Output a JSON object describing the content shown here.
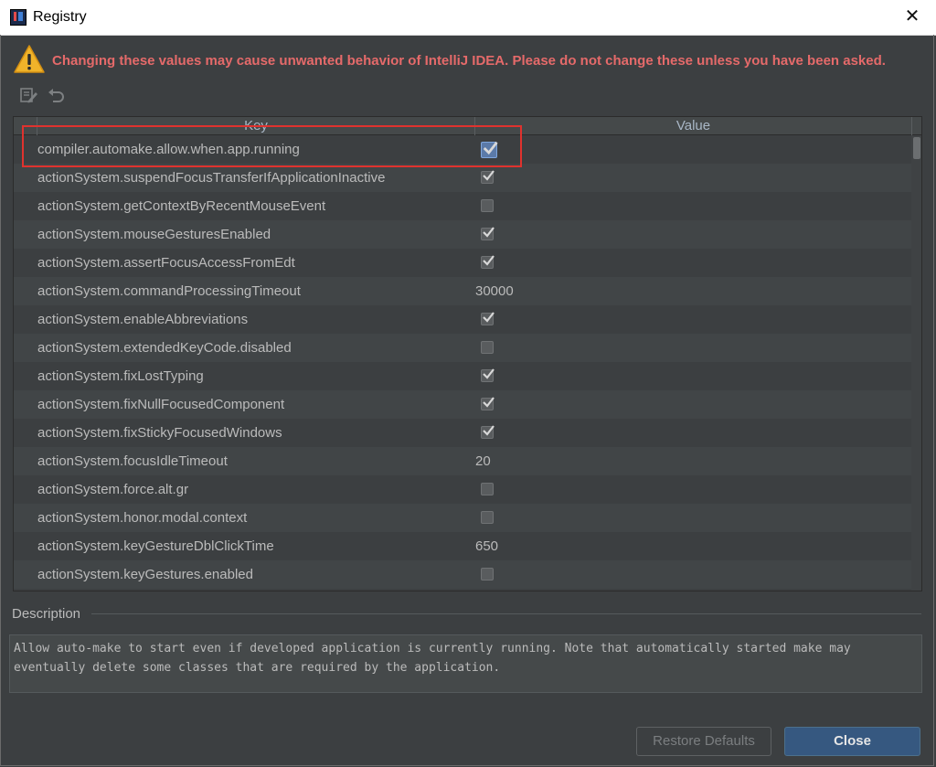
{
  "window": {
    "title": "Registry",
    "close_glyph": "✕"
  },
  "warning": {
    "icon": "warning-triangle-icon",
    "text": "Changing these values may cause unwanted behavior of IntelliJ IDEA. Please do not change these unless you have been asked."
  },
  "toolbar": {
    "edit_icon": "edit-icon",
    "undo_icon": "revert-icon"
  },
  "table": {
    "headers": {
      "key": "Key",
      "value": "Value"
    },
    "rows": [
      {
        "key": "compiler.automake.allow.when.app.running",
        "type": "checkbox",
        "checked": true
      },
      {
        "key": "actionSystem.suspendFocusTransferIfApplicationInactive",
        "type": "checkbox",
        "checked": true
      },
      {
        "key": "actionSystem.getContextByRecentMouseEvent",
        "type": "checkbox",
        "checked": false
      },
      {
        "key": "actionSystem.mouseGesturesEnabled",
        "type": "checkbox",
        "checked": true
      },
      {
        "key": "actionSystem.assertFocusAccessFromEdt",
        "type": "checkbox",
        "checked": true
      },
      {
        "key": "actionSystem.commandProcessingTimeout",
        "type": "text",
        "value": "30000"
      },
      {
        "key": "actionSystem.enableAbbreviations",
        "type": "checkbox",
        "checked": true
      },
      {
        "key": "actionSystem.extendedKeyCode.disabled",
        "type": "checkbox",
        "checked": false
      },
      {
        "key": "actionSystem.fixLostTyping",
        "type": "checkbox",
        "checked": true
      },
      {
        "key": "actionSystem.fixNullFocusedComponent",
        "type": "checkbox",
        "checked": true
      },
      {
        "key": "actionSystem.fixStickyFocusedWindows",
        "type": "checkbox",
        "checked": true
      },
      {
        "key": "actionSystem.focusIdleTimeout",
        "type": "text",
        "value": "20"
      },
      {
        "key": "actionSystem.force.alt.gr",
        "type": "checkbox",
        "checked": false
      },
      {
        "key": "actionSystem.honor.modal.context",
        "type": "checkbox",
        "checked": false
      },
      {
        "key": "actionSystem.keyGestureDblClickTime",
        "type": "text",
        "value": "650"
      },
      {
        "key": "actionSystem.keyGestures.enabled",
        "type": "checkbox",
        "checked": false
      }
    ]
  },
  "description": {
    "label": "Description",
    "text": "Allow auto-make to start even if developed application is currently running. Note that automatically started make may eventually delete some classes that are required by the application."
  },
  "buttons": {
    "restore": "Restore Defaults",
    "close": "Close"
  },
  "colors": {
    "warning_text": "#e56a6a",
    "highlight_box": "#e0322e",
    "primary_button": "#365880"
  }
}
